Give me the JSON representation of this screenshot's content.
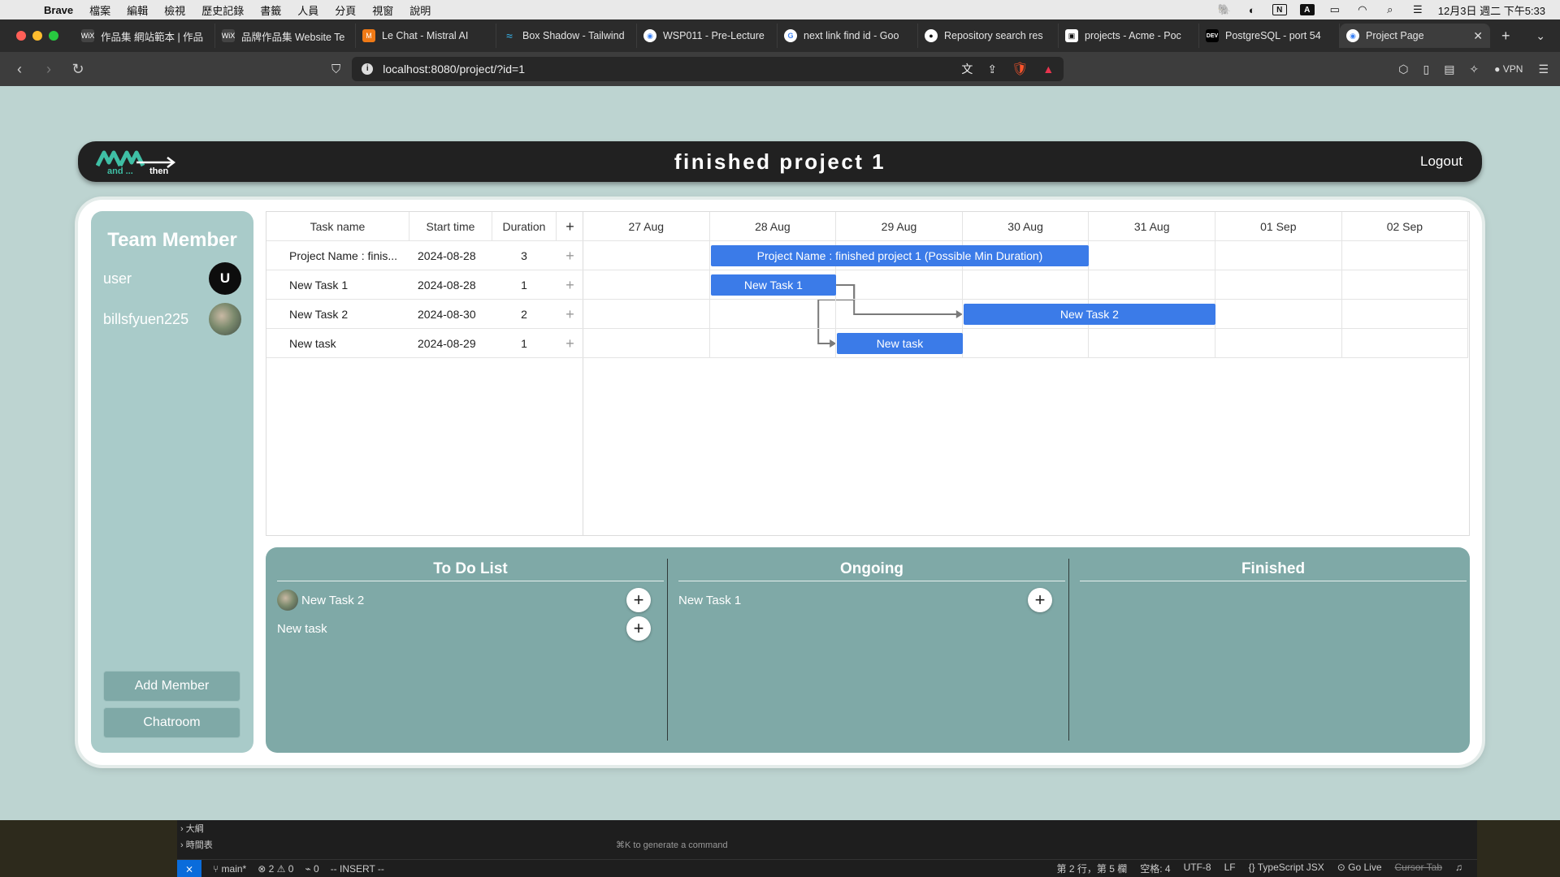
{
  "menubar": {
    "app": "Brave",
    "items": [
      "檔案",
      "編輯",
      "檢視",
      "歷史記錄",
      "書籤",
      "人員",
      "分頁",
      "視窗",
      "說明"
    ],
    "datetime": "12月3日 週二 下午5:33"
  },
  "browser": {
    "tabs": [
      {
        "title": "作品集 網站範本 | 作品",
        "icon_color": "#444444",
        "icon": "WiX"
      },
      {
        "title": "品牌作品集 Website Te",
        "icon_color": "#444444",
        "icon": "WiX"
      },
      {
        "title": "Le Chat - Mistral AI",
        "icon_color": "#f07a16",
        "icon": "M"
      },
      {
        "title": "Box Shadow - Tailwind",
        "icon_color": "#38bdf8",
        "icon": "~"
      },
      {
        "title": "WSP011 - Pre-Lecture",
        "icon_color": "#3b82f6",
        "icon": "W"
      },
      {
        "title": "next link find id - Goo",
        "icon_color": "#ffffff",
        "icon": "G"
      },
      {
        "title": "Repository search res",
        "icon_color": "#ffffff",
        "icon": "gh"
      },
      {
        "title": "projects - Acme - Poc",
        "icon_color": "#ffffff",
        "icon": "P"
      },
      {
        "title": "PostgreSQL - port 54",
        "icon_color": "#000000",
        "icon": "DEV"
      },
      {
        "title": "Project Page",
        "icon_color": "#3b82f6",
        "icon": "P"
      }
    ],
    "url": "localhost:8080/project/?id=1",
    "vpn_label": "VPN"
  },
  "app": {
    "title": "finished project 1",
    "logo_text_left": "and ...",
    "logo_text_right": "then",
    "logout_label": "Logout"
  },
  "sidebar": {
    "heading": "Team Member",
    "members": [
      {
        "name": "user",
        "initial": "U",
        "avatar_color": "#0d0d0d"
      },
      {
        "name": "billsfyuen225",
        "initial": "",
        "avatar_color": "#6b7d6f"
      }
    ],
    "add_member_label": "Add Member",
    "chatroom_label": "Chatroom"
  },
  "gantt": {
    "columns": {
      "task": "Task name",
      "start": "Start time",
      "duration": "Duration",
      "add": "+"
    },
    "dates": [
      "27 Aug",
      "28 Aug",
      "29 Aug",
      "30 Aug",
      "31 Aug",
      "01 Sep",
      "02 Sep"
    ],
    "tasks": [
      {
        "name": "Project Name : finis...",
        "start": "2024-08-28",
        "duration": "3",
        "bar_label": "Project Name : finished project 1 (Possible Min Duration)"
      },
      {
        "name": "New Task 1",
        "start": "2024-08-28",
        "duration": "1",
        "bar_label": "New Task 1"
      },
      {
        "name": "New Task 2",
        "start": "2024-08-30",
        "duration": "2",
        "bar_label": "New Task 2"
      },
      {
        "name": "New task",
        "start": "2024-08-29",
        "duration": "1",
        "bar_label": "New task"
      }
    ],
    "bar_color": "#3b7be8"
  },
  "board": {
    "columns": [
      {
        "title": "To Do List",
        "items": [
          {
            "label": "New Task 2",
            "has_avatar": true
          },
          {
            "label": "New task",
            "has_avatar": false
          }
        ]
      },
      {
        "title": "Ongoing",
        "items": [
          {
            "label": "New Task 1",
            "has_avatar": false
          }
        ]
      },
      {
        "title": "Finished",
        "items": []
      }
    ],
    "add_symbol": "+"
  },
  "editor": {
    "tree": [
      "大綱",
      "時間表"
    ],
    "hint": "⌘K to generate a command",
    "branch": "main*",
    "errors": "2",
    "warnings": "0",
    "ports": "0",
    "mode": "-- INSERT --",
    "position": "第 2 行，第 5 欄",
    "spaces": "空格: 4",
    "encoding": "UTF-8",
    "eol": "LF",
    "language": "TypeScript JSX",
    "golive": "Go Live",
    "cursor_tab": "Cursor Tab"
  }
}
